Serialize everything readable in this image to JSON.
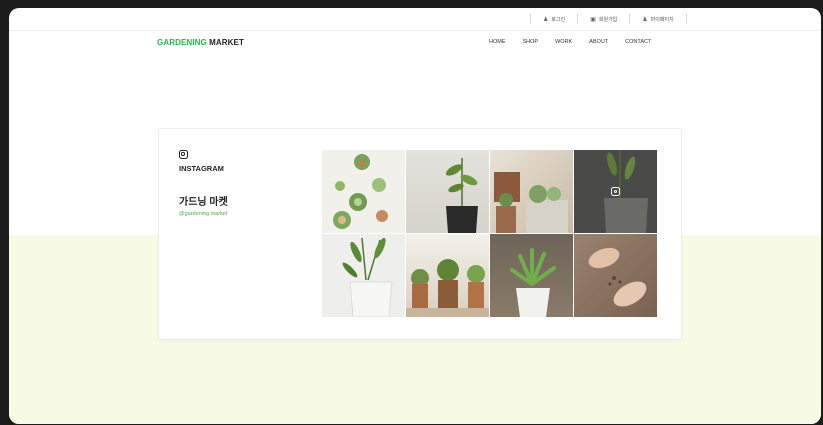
{
  "utility_nav": [
    {
      "icon": "user-icon",
      "label": "로그인"
    },
    {
      "icon": "id-card-icon",
      "label": "회원가입"
    },
    {
      "icon": "person-icon",
      "label": "마이페이지"
    }
  ],
  "logo": {
    "part1": "GARDENING",
    "part2": "MARKET"
  },
  "nav": [
    "HOME",
    "SHOP",
    "WORK",
    "ABOUT",
    "CONTACT"
  ],
  "instagram": {
    "section_label": "INSTAGRAM",
    "brand_name": "가드닝 마켓",
    "handle": "@gardening.market"
  },
  "colors": {
    "brand_green": "#2bb24c",
    "band_bg": "#f8fbe3"
  }
}
